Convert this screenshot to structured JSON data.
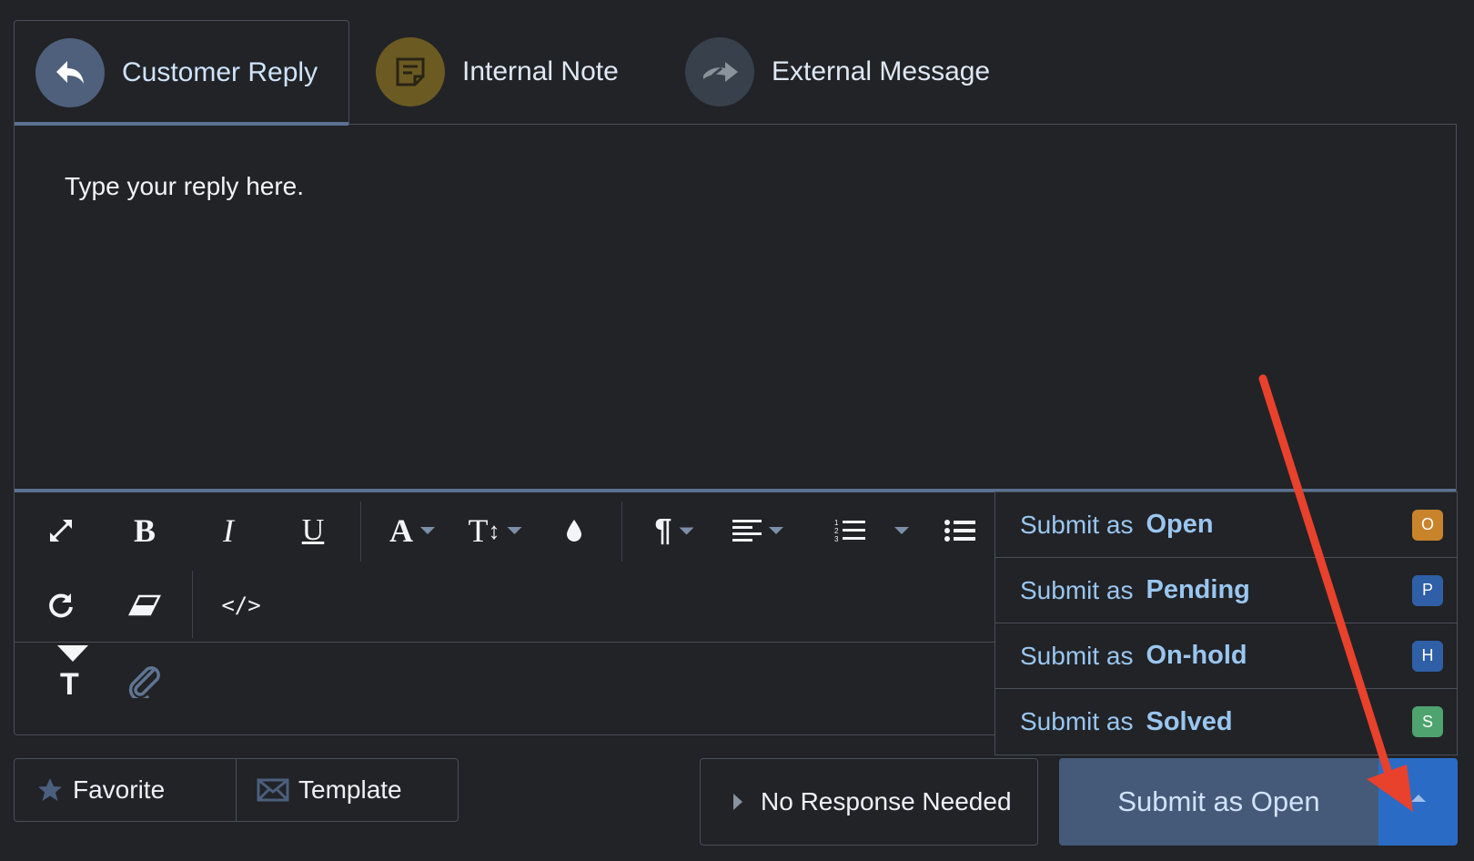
{
  "tabs": [
    {
      "label": "Customer Reply",
      "icon": "reply-arrow-icon",
      "active": true
    },
    {
      "label": "Internal Note",
      "icon": "note-icon",
      "active": false
    },
    {
      "label": "External Message",
      "icon": "forward-arrows-icon",
      "active": false
    }
  ],
  "editor": {
    "placeholder": "Type your reply here."
  },
  "toolbar": {
    "row1": [
      "expand-icon",
      "bold-icon",
      "italic-icon",
      "underline-icon",
      "font-color-icon",
      "font-size-icon",
      "ink-drop-icon",
      "paragraph-icon",
      "align-icon",
      "ordered-list-icon",
      "unordered-list-icon"
    ],
    "row2": [
      "redo-icon",
      "eraser-icon",
      "code-view-icon"
    ],
    "bold_glyph": "B",
    "italic_glyph": "I",
    "underline_glyph": "U",
    "font_glyph": "A",
    "size_glyph": "T",
    "paragraph_glyph": "¶",
    "code_glyph": "</>",
    "format_toggle": "T"
  },
  "submit_menu": {
    "prefix": "Submit as",
    "items": [
      {
        "status": "Open",
        "badge": "O",
        "badge_color": "#c9842b"
      },
      {
        "status": "Pending",
        "badge": "P",
        "badge_color": "#2f5fa7"
      },
      {
        "status": "On-hold",
        "badge": "H",
        "badge_color": "#2f5fa7"
      },
      {
        "status": "Solved",
        "badge": "S",
        "badge_color": "#4ea36e"
      }
    ]
  },
  "bottom_bar": {
    "favorite_label": "Favorite",
    "template_label": "Template",
    "no_response_label": "No Response Needed",
    "submit_label": "Submit as Open"
  },
  "colors": {
    "accent": "#5b7191",
    "submit_main": "#455a78",
    "submit_toggle": "#2a6cc5",
    "annotation_arrow": "#e8412c"
  }
}
